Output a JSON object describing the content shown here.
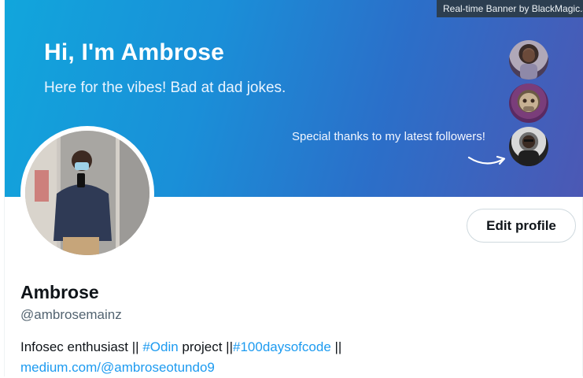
{
  "banner": {
    "tag": "Real-time Banner by BlackMagic.s",
    "title": "Hi, I'm Ambrose",
    "subtitle": "Here for the vibes! Bad at dad jokes.",
    "thanks": "Special thanks to my latest followers!"
  },
  "profile": {
    "edit_button": "Edit profile",
    "name": "Ambrose",
    "handle": "@ambrosemainz",
    "bio": {
      "part1": "Infosec enthusiast || ",
      "tag1": "#Odin",
      "part2": " project ||",
      "tag2": "#100daysofcode",
      "part3": " ||",
      "link": "medium.com/@ambroseotundo9"
    }
  },
  "colors": {
    "accent": "#1d9bf0",
    "text": "#0f1419",
    "muted": "#536471"
  }
}
